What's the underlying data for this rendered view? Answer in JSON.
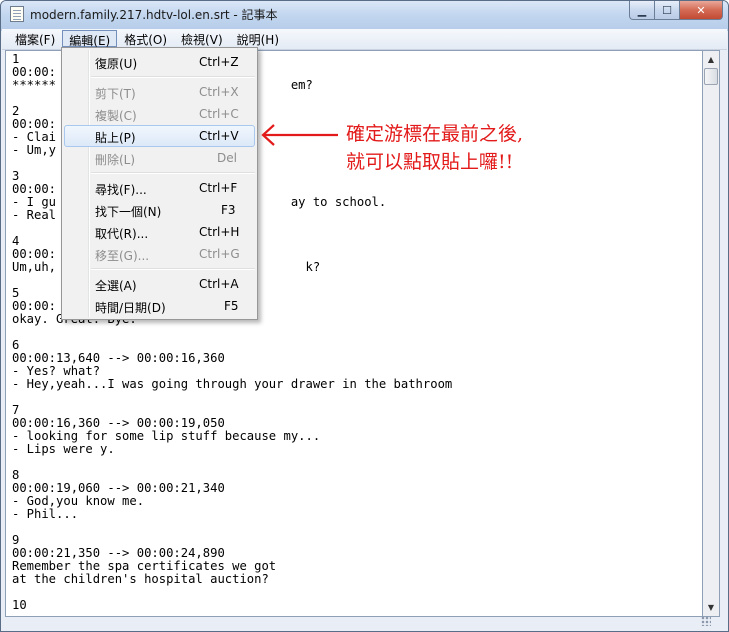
{
  "window": {
    "title": "modern.family.217.hdtv-lol.en.srt - 記事本",
    "controls": {
      "minimize": "▁",
      "maximize": "☐",
      "close": "✕"
    }
  },
  "menubar": {
    "file": "檔案(F)",
    "edit": "編輯(E)",
    "format": "格式(O)",
    "view": "檢視(V)",
    "help": "說明(H)"
  },
  "editor": {
    "text": "1\n00:00:\n******                                em?\n\n2\n00:00:\n- Clai\n- Um,y\n\n3\n00:00:\n- I gu                                ay to school.\n- Real\n\n4\n00:00:\nUm,uh,                                  k?\n\n5\n00:00:\nokay. Great. Bye.\n\n6\n00:00:13,640 --> 00:00:16,360\n- Yes? what?\n- Hey,yeah...I was going through your drawer in the bathroom\n\n7\n00:00:16,360 --> 00:00:19,050\n- looking for some lip stuff because my...\n- Lips were y.\n\n8\n00:00:19,060 --> 00:00:21,340\n- God,you know me.\n- Phil...\n\n9\n00:00:21,350 --> 00:00:24,890\nRemember the spa certificates we got\nat the children's hospital auction?\n\n10"
  },
  "edit_menu": {
    "items": [
      {
        "label": "復原(U)",
        "shortcut": "Ctrl+Z"
      },
      {
        "label": "剪下(T)",
        "shortcut": "Ctrl+X"
      },
      {
        "label": "複製(C)",
        "shortcut": "Ctrl+C"
      },
      {
        "label": "貼上(P)",
        "shortcut": "Ctrl+V"
      },
      {
        "label": "刪除(L)",
        "shortcut": "Del"
      },
      {
        "label": "尋找(F)...",
        "shortcut": "Ctrl+F"
      },
      {
        "label": "找下一個(N)",
        "shortcut": "F3"
      },
      {
        "label": "取代(R)...",
        "shortcut": "Ctrl+H"
      },
      {
        "label": "移至(G)...",
        "shortcut": "Ctrl+G"
      },
      {
        "label": "全選(A)",
        "shortcut": "Ctrl+A"
      },
      {
        "label": "時間/日期(D)",
        "shortcut": "F5"
      }
    ]
  },
  "annotation": {
    "line1": "確定游標在最前之後,",
    "line2": "就可以點取貼上囉!!",
    "color": "#e31a1a"
  },
  "scrollbar": {
    "up_arrow": "▲",
    "down_arrow": "▼"
  }
}
